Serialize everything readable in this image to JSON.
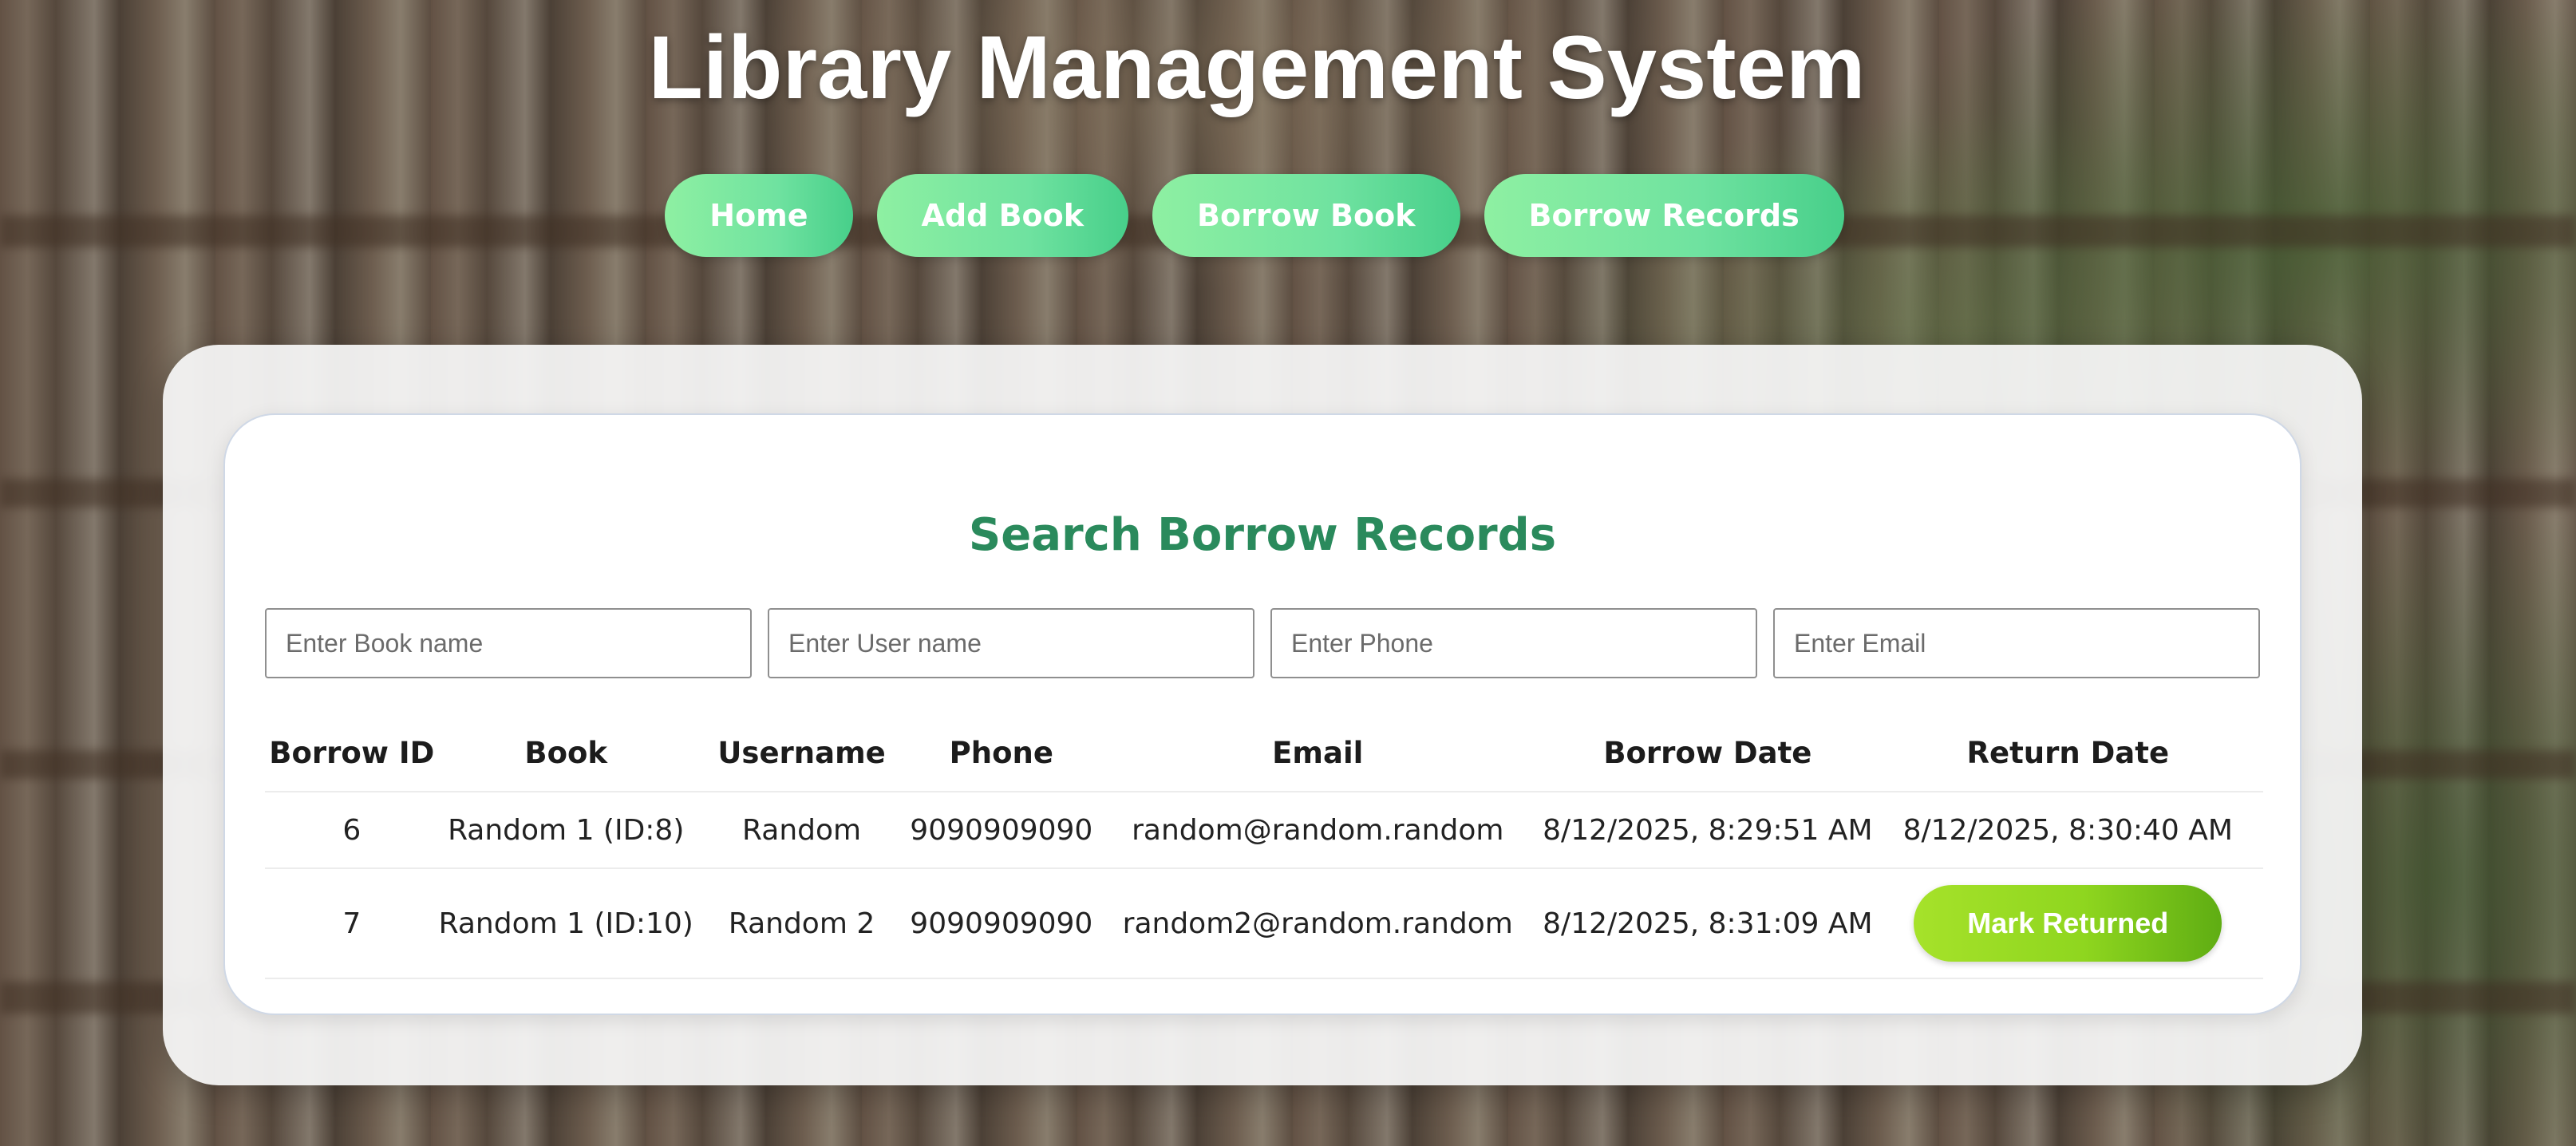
{
  "app": {
    "title": "Library Management System"
  },
  "nav": {
    "items": [
      {
        "label": "Home"
      },
      {
        "label": "Add Book"
      },
      {
        "label": "Borrow Book"
      },
      {
        "label": "Borrow Records"
      }
    ]
  },
  "search": {
    "title": "Search Borrow Records",
    "book_placeholder": "Enter Book name",
    "user_placeholder": "Enter User name",
    "phone_placeholder": "Enter Phone",
    "email_placeholder": "Enter Email"
  },
  "table": {
    "headers": [
      "Borrow ID",
      "Book",
      "Username",
      "Phone",
      "Email",
      "Borrow Date",
      "Return Date"
    ],
    "rows": [
      {
        "borrow_id": "6",
        "book": "Random 1 (ID:8)",
        "username": "Random",
        "phone": "9090909090",
        "email": "random@random.random",
        "borrow_date": "8/12/2025, 8:29:51 AM",
        "return_date": "8/12/2025, 8:30:40 AM"
      },
      {
        "borrow_id": "7",
        "book": "Random 1 (ID:10)",
        "username": "Random 2",
        "phone": "9090909090",
        "email": "random2@random.random",
        "borrow_date": "8/12/2025, 8:31:09 AM",
        "return_action_label": "Mark Returned"
      }
    ]
  },
  "colors": {
    "title_green": "#2a8a5c",
    "nav_gradient_start": "#8ef0a2",
    "nav_gradient_end": "#47cf8a",
    "mark_returned_start": "#a6e22a",
    "mark_returned_end": "#5fad13"
  }
}
